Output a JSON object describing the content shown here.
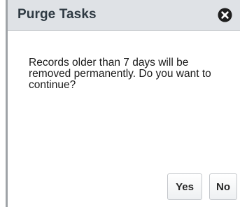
{
  "dialog": {
    "title": "Purge Tasks",
    "close_icon": "close-circle-icon",
    "message": "Records older than 7 days will be removed permanently. Do you want to continue?",
    "buttons": {
      "yes_label": "Yes",
      "no_label": "No"
    }
  },
  "colors": {
    "header_background": "#dfe2e6",
    "title_text": "#2f3a43",
    "border": "#9fa3a7"
  }
}
